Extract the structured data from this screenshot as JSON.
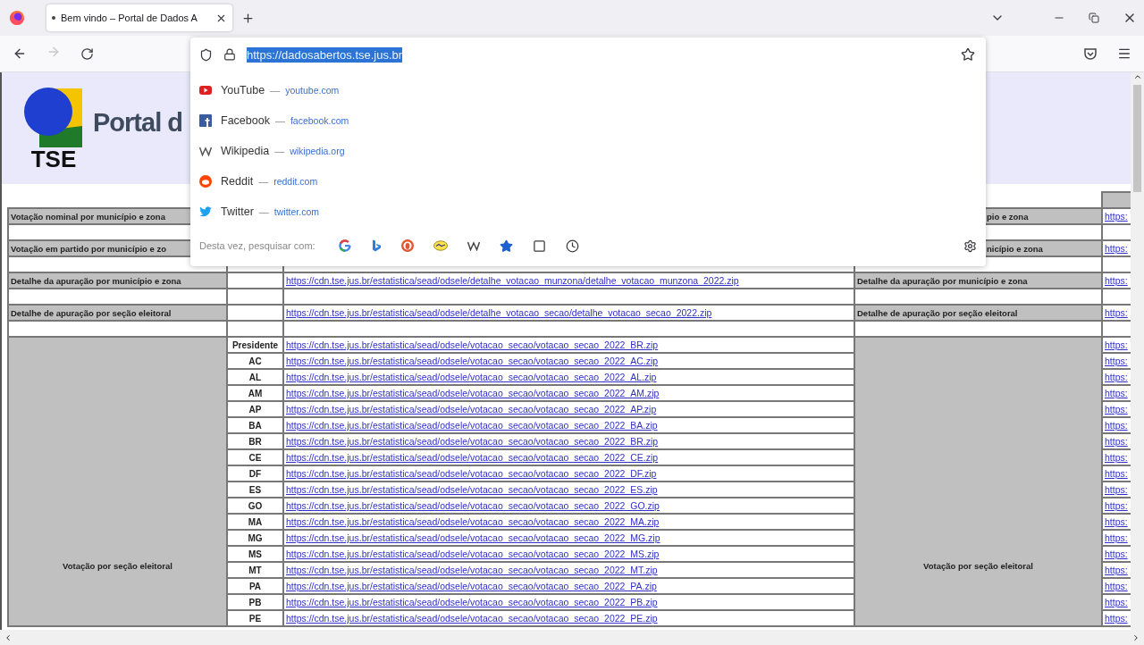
{
  "tab": {
    "title": "Bem vindo – Portal de Dados A",
    "selected": true
  },
  "nav": {
    "forward_disabled": true
  },
  "address": {
    "value": "https://dadosabertos.tse.jus.br",
    "selected": true
  },
  "suggestions": [
    {
      "name": "YouTube",
      "separator": "—",
      "domain": "youtube.com"
    },
    {
      "name": "Facebook",
      "separator": "—",
      "domain": "facebook.com"
    },
    {
      "name": "Wikipedia",
      "separator": "—",
      "domain": "wikipedia.org"
    },
    {
      "name": "Reddit",
      "separator": "—",
      "domain": "reddit.com"
    },
    {
      "name": "Twitter",
      "separator": "—",
      "domain": "twitter.com"
    }
  ],
  "search_with": {
    "label": "Desta vez, pesquisar com:"
  },
  "header": {
    "logo_text": "TSE",
    "title": "Portal d"
  },
  "table": {
    "rows": [
      {
        "kind": "top"
      },
      {
        "kind": "label",
        "left": "Votação nominal por município e zona",
        "right": "pio e zona",
        "right_link": "https:"
      },
      {
        "kind": "blank"
      },
      {
        "kind": "label",
        "left": "Votação em partido por município e zo",
        "right": "nicípio e zona",
        "right_link": "https:"
      },
      {
        "kind": "blank"
      },
      {
        "kind": "label",
        "left": "Detalhe da apuração por município e zona",
        "link": "https://cdn.tse.jus.br/estatistica/sead/odsele/detalhe_votacao_munzona/detalhe_votacao_munzona_2022.zip",
        "right": "Detalhe da apuração por município e zona",
        "right_link": "https:"
      },
      {
        "kind": "blank"
      },
      {
        "kind": "label",
        "left": "Detalhe de apuração por seção eleitoral",
        "link": "https://cdn.tse.jus.br/estatistica/sead/odsele/detalhe_votacao_secao/detalhe_votacao_secao_2022.zip",
        "right": "Detalhe de apuração por seção eleitoral",
        "right_link": "https:"
      },
      {
        "kind": "blank"
      },
      {
        "kind": "group",
        "left": "Votação por seção eleitoral",
        "right": "Votação por seção eleitoral",
        "items": [
          {
            "uf": "Presidente",
            "link": "https://cdn.tse.jus.br/estatistica/sead/odsele/votacao_secao/votacao_secao_2022_BR.zip",
            "right_link": "https:"
          },
          {
            "uf": "AC",
            "link": "https://cdn.tse.jus.br/estatistica/sead/odsele/votacao_secao/votacao_secao_2022_AC.zip",
            "right_link": "https:"
          },
          {
            "uf": "AL",
            "link": "https://cdn.tse.jus.br/estatistica/sead/odsele/votacao_secao/votacao_secao_2022_AL.zip",
            "right_link": "https:"
          },
          {
            "uf": "AM",
            "link": "https://cdn.tse.jus.br/estatistica/sead/odsele/votacao_secao/votacao_secao_2022_AM.zip",
            "right_link": "https:"
          },
          {
            "uf": "AP",
            "link": "https://cdn.tse.jus.br/estatistica/sead/odsele/votacao_secao/votacao_secao_2022_AP.zip",
            "right_link": "https:"
          },
          {
            "uf": "BA",
            "link": "https://cdn.tse.jus.br/estatistica/sead/odsele/votacao_secao/votacao_secao_2022_BA.zip",
            "right_link": "https:"
          },
          {
            "uf": "BR",
            "link": "https://cdn.tse.jus.br/estatistica/sead/odsele/votacao_secao/votacao_secao_2022_BR.zip",
            "right_link": "https:"
          },
          {
            "uf": "CE",
            "link": "https://cdn.tse.jus.br/estatistica/sead/odsele/votacao_secao/votacao_secao_2022_CE.zip",
            "right_link": "https:"
          },
          {
            "uf": "DF",
            "link": "https://cdn.tse.jus.br/estatistica/sead/odsele/votacao_secao/votacao_secao_2022_DF.zip",
            "right_link": "https:"
          },
          {
            "uf": "ES",
            "link": "https://cdn.tse.jus.br/estatistica/sead/odsele/votacao_secao/votacao_secao_2022_ES.zip",
            "right_link": "https:"
          },
          {
            "uf": "GO",
            "link": "https://cdn.tse.jus.br/estatistica/sead/odsele/votacao_secao/votacao_secao_2022_GO.zip",
            "right_link": "https:"
          },
          {
            "uf": "MA",
            "link": "https://cdn.tse.jus.br/estatistica/sead/odsele/votacao_secao/votacao_secao_2022_MA.zip",
            "right_link": "https:"
          },
          {
            "uf": "MG",
            "link": "https://cdn.tse.jus.br/estatistica/sead/odsele/votacao_secao/votacao_secao_2022_MG.zip",
            "right_link": "https:"
          },
          {
            "uf": "MS",
            "link": "https://cdn.tse.jus.br/estatistica/sead/odsele/votacao_secao/votacao_secao_2022_MS.zip",
            "right_link": "https:"
          },
          {
            "uf": "MT",
            "link": "https://cdn.tse.jus.br/estatistica/sead/odsele/votacao_secao/votacao_secao_2022_MT.zip",
            "right_link": "https:"
          },
          {
            "uf": "PA",
            "link": "https://cdn.tse.jus.br/estatistica/sead/odsele/votacao_secao/votacao_secao_2022_PA.zip",
            "right_link": "https:"
          },
          {
            "uf": "PB",
            "link": "https://cdn.tse.jus.br/estatistica/sead/odsele/votacao_secao/votacao_secao_2022_PB.zip",
            "right_link": "https:"
          },
          {
            "uf": "PE",
            "link": "https://cdn.tse.jus.br/estatistica/sead/odsele/votacao_secao/votacao_secao_2022_PE.zip",
            "right_link": "https:"
          }
        ]
      }
    ]
  }
}
